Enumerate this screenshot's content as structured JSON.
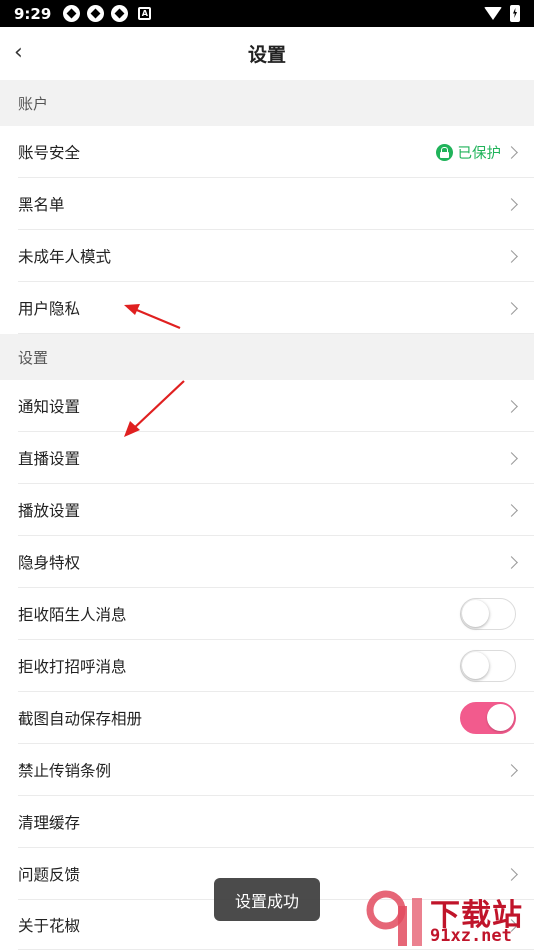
{
  "status_bar": {
    "time": "9:29",
    "notification_icons": [
      "app-icon",
      "app-icon",
      "app-icon",
      "a-icon"
    ],
    "a_icon_text": "A"
  },
  "header": {
    "title": "设置"
  },
  "sections": {
    "account": {
      "title": "账户"
    },
    "settings": {
      "title": "设置"
    }
  },
  "account_items": [
    {
      "label": "账号安全",
      "status": "已保护",
      "status_color": "#20b35a"
    },
    {
      "label": "黑名单"
    },
    {
      "label": "未成年人模式"
    },
    {
      "label": "用户隐私"
    }
  ],
  "settings_items": [
    {
      "label": "通知设置"
    },
    {
      "label": "直播设置"
    },
    {
      "label": "播放设置"
    },
    {
      "label": "隐身特权"
    },
    {
      "label": "拒收陌生人消息",
      "toggle": false
    },
    {
      "label": "拒收打招呼消息",
      "toggle": false
    },
    {
      "label": "截图自动保存相册",
      "toggle": true
    },
    {
      "label": "禁止传销条例"
    },
    {
      "label": "清理缓存"
    },
    {
      "label": "问题反馈"
    },
    {
      "label": "关于花椒"
    }
  ],
  "toast": {
    "text": "设置成功"
  },
  "watermark": {
    "text": "下载站",
    "url": "91xz.net"
  },
  "colors": {
    "toggle_on": "#f25b8d",
    "annotation_arrow": "#e02020"
  }
}
